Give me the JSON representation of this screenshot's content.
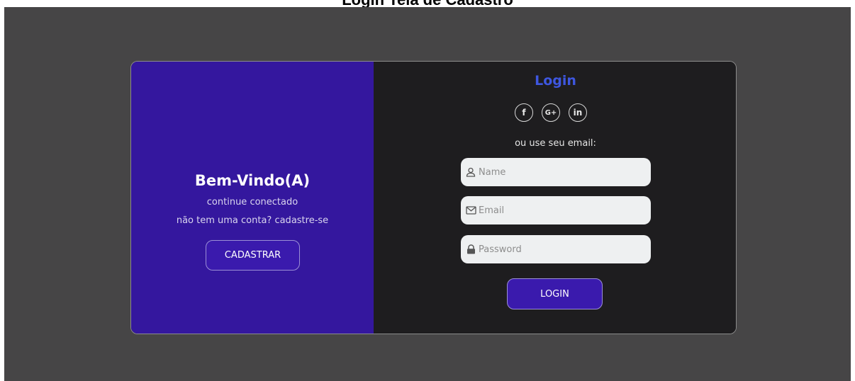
{
  "page": {
    "header_text": "Login Tela de Cadastro"
  },
  "welcome": {
    "title": "Bem-Vindo(A)",
    "line1": "continue conectado",
    "line2": "não tem uma conta? cadastre-se",
    "register_button": "CADASTRAR"
  },
  "login": {
    "title": "Login",
    "social": [
      {
        "icon": "facebook-icon",
        "glyph": "f"
      },
      {
        "icon": "google-plus-icon",
        "glyph": "G+"
      },
      {
        "icon": "linkedin-icon",
        "glyph": "in"
      }
    ],
    "email_hint": "ou use seu email:",
    "fields": {
      "name_placeholder": "Name",
      "email_placeholder": "Email",
      "password_placeholder": "Password"
    },
    "login_button": "LOGIN"
  },
  "colors": {
    "backdrop": "#464546",
    "welcome_panel": "#34179e",
    "login_panel": "#1e1d1f",
    "accent_title": "#3e57e0",
    "button": "#3a1aad"
  }
}
